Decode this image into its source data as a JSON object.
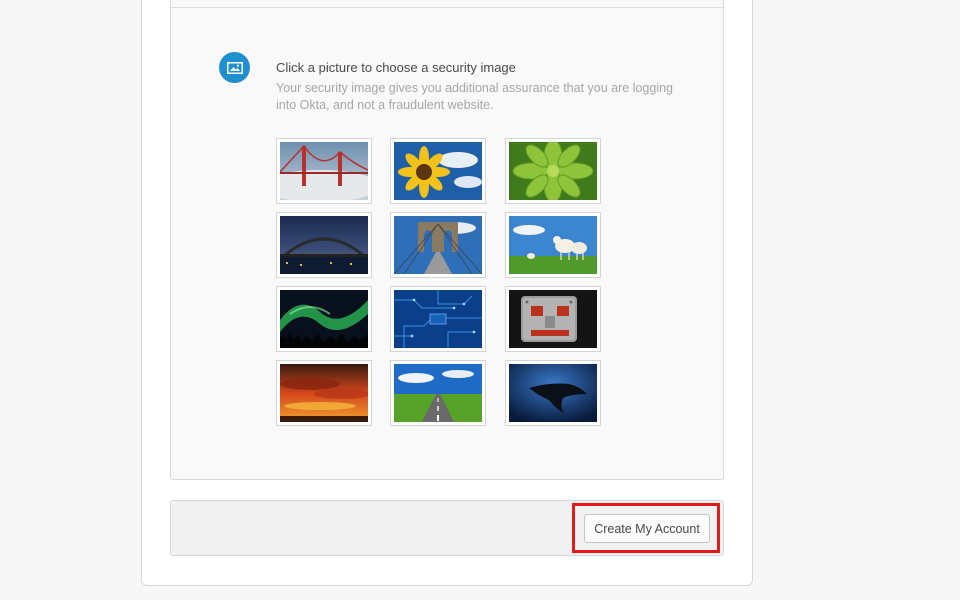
{
  "security_image": {
    "title": "Click a picture to choose a security image",
    "description": "Your security image gives you additional assurance that you are logging into Okta, and not a fraudulent website.",
    "icon": "image-icon",
    "images": [
      {
        "name": "golden-gate-bridge"
      },
      {
        "name": "sunflower"
      },
      {
        "name": "green-succulent"
      },
      {
        "name": "sydney-harbour-bridge"
      },
      {
        "name": "brooklyn-bridge"
      },
      {
        "name": "lambs-in-field"
      },
      {
        "name": "aurora-borealis"
      },
      {
        "name": "circuit-board"
      },
      {
        "name": "robot-toy"
      },
      {
        "name": "sunset-clouds"
      },
      {
        "name": "open-road"
      },
      {
        "name": "manta-ray"
      }
    ]
  },
  "footer": {
    "create_account_label": "Create My Account"
  },
  "colors": {
    "accent": "#1f8fce",
    "highlight": "#e01b1b"
  }
}
